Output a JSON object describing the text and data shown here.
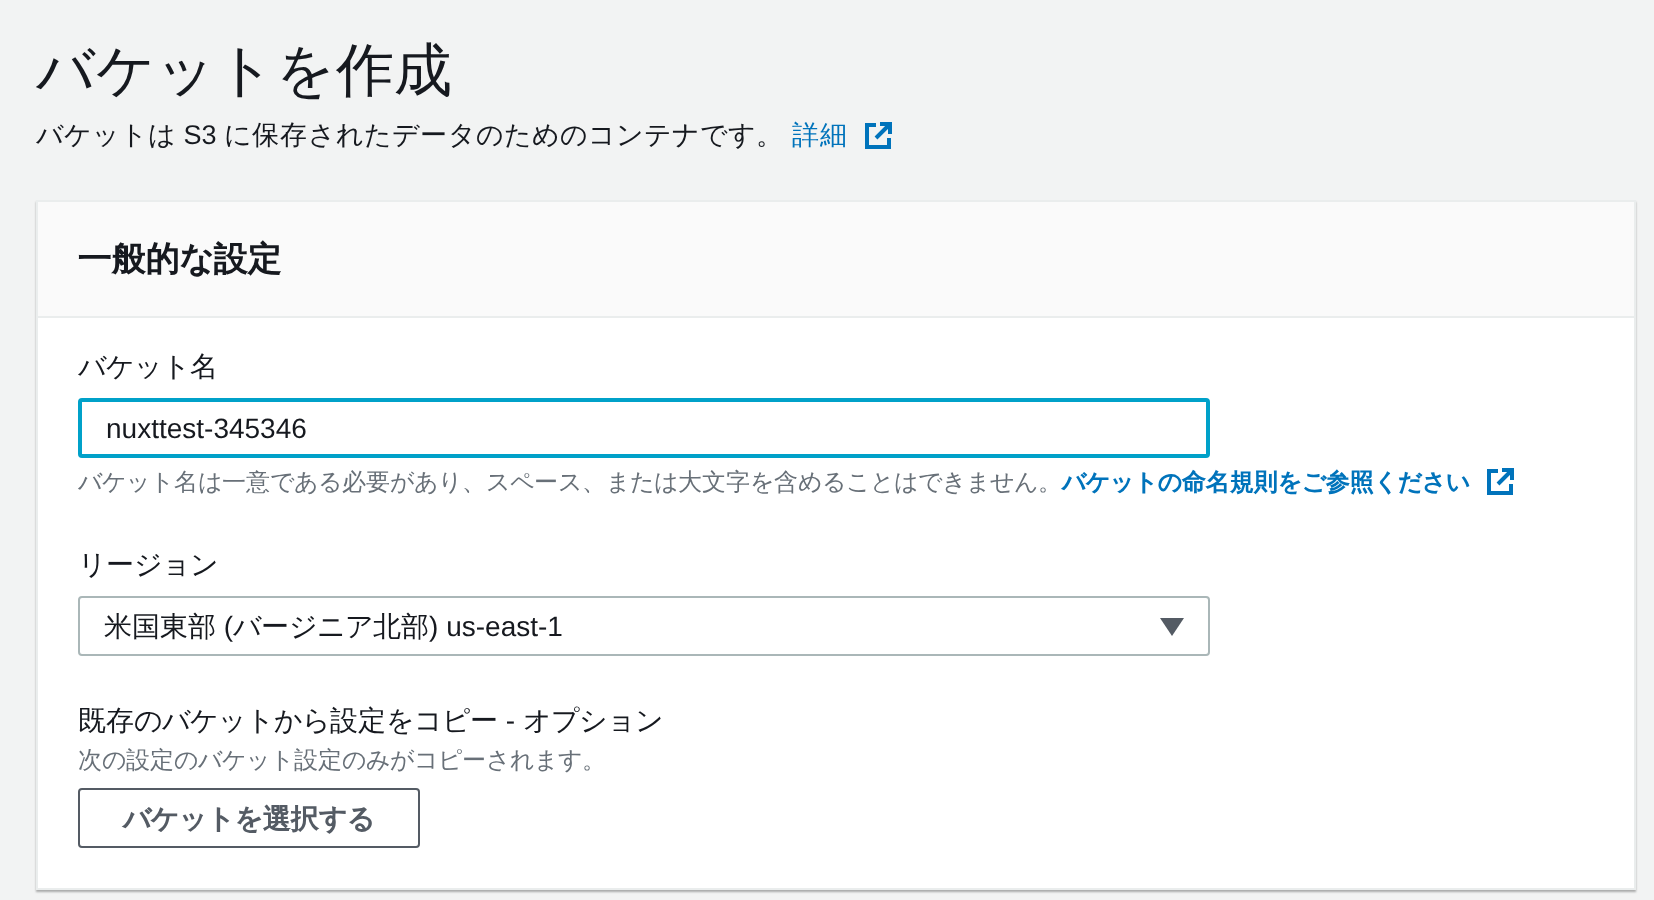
{
  "page": {
    "title": "バケットを作成",
    "description": "バケットは S3 に保存されたデータのためのコンテナです。",
    "description_link": "詳細"
  },
  "panel": {
    "title": "一般的な設定",
    "bucket_name": {
      "label": "バケット名",
      "value": "nuxttest-345346",
      "focused": true,
      "hint": "バケット名は一意である必要があり、スペース、または大文字を含めることはできません。",
      "hint_link": "バケットの命名規則をご参照ください"
    },
    "region": {
      "label": "リージョン",
      "value": "米国東部 (バージニア北部) us-east-1"
    },
    "copy_settings": {
      "label": "既存のバケットから設定をコピー - オプション",
      "description": "次の設定のバケット設定のみがコピーされます。",
      "button": "バケットを選択する"
    }
  }
}
